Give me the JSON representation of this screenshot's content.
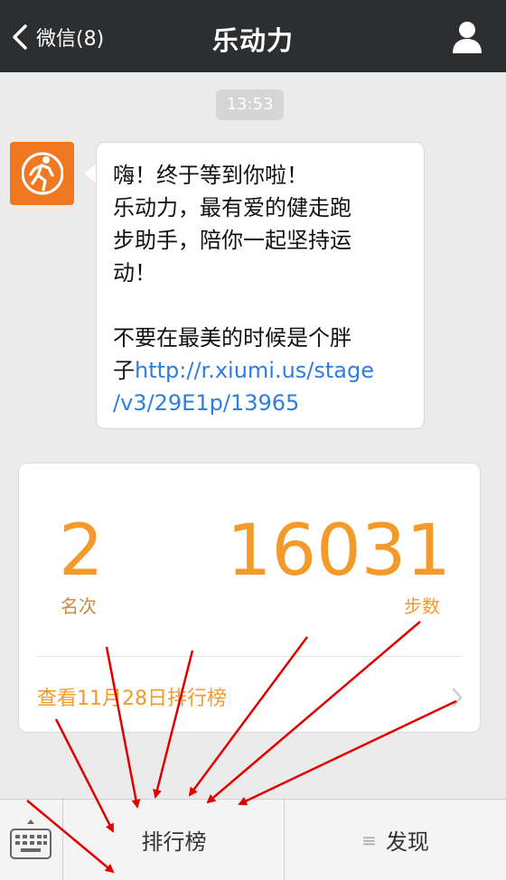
{
  "header": {
    "back_label": "微信(8)",
    "title": "乐动力"
  },
  "chat": {
    "timestamp": "13:53",
    "message_text": "嗨！终于等到你啦！\n乐动力，最有爱的健走跑\n步助手，陪你一起坚持运\n动！\n\n不要在最美的时候是个胖\n子",
    "message_link": "http://r.xiumi.us/stage\n/v3/29E1p/13965"
  },
  "card": {
    "rank_value": "2",
    "rank_label": "名次",
    "steps_value": "16031",
    "steps_label": "步数",
    "view_link": "查看11月28日排行榜"
  },
  "bottom_bar": {
    "tab1_label": "排行榜",
    "tab2_label": "发现",
    "tab2_icon": "≡"
  },
  "colors": {
    "accent": "#f39a2b",
    "avatar_bg": "#f07820",
    "link": "#2f7de1",
    "header_bg": "#2d2e30",
    "annotation_arrow": "#e00000"
  }
}
